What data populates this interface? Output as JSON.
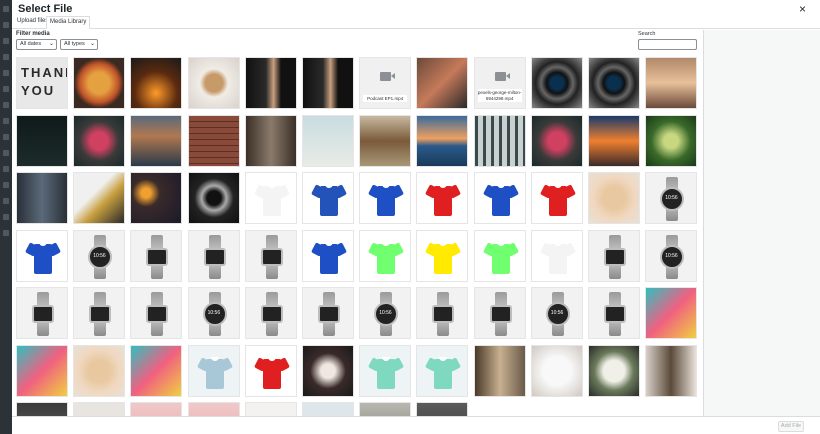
{
  "modal": {
    "title": "Select File",
    "close_glyph": "×"
  },
  "tabs": [
    {
      "label": "Upload files",
      "active": false
    },
    {
      "label": "Media Library",
      "active": true
    }
  ],
  "filters": {
    "label": "Filter media",
    "dates": "All dates",
    "types": "All types"
  },
  "search": {
    "label": "Search",
    "value": ""
  },
  "footer": {
    "add_label": "Add File"
  },
  "media": [
    [
      "text-thankyou",
      "pizza",
      "campfire",
      "coffee",
      "person-mic",
      "person-mic",
      "video:Podcast EP1.mp4",
      "person-laptop",
      "video:pexels-george-milton-6944298.mp4",
      "lens",
      "lens",
      "crowd"
    ],
    [
      "dark-silhouette",
      "red-rose",
      "lake",
      "brick-wall",
      "alley",
      "beach-pale",
      "dog-running",
      "sunset-sea",
      "forest",
      "red-rose",
      "sunset-sky",
      "forest-green"
    ],
    [
      "alley-dark",
      "hand-white",
      "bokeh-lights",
      "camera-lens",
      "shirt:#f4f4f4",
      "shirt-model:#2352b8",
      "shirt:#1f4fc4",
      "shirt:#e02020",
      "shirt:#1f4fc4",
      "shirt:#e02020",
      "tarts",
      "watch"
    ],
    [
      "shirt:#1f4fc4",
      "watch",
      "smartwatch",
      "smartwatch",
      "smartwatch",
      "shirt:#1f4fc4",
      "shirt:#6fff6f",
      "shirt:#ffea00",
      "shirt:#6fff6f",
      "shirt:#f4f4f4",
      "smartwatch",
      "watch"
    ],
    [
      "smartwatch",
      "smartwatch",
      "smartwatch",
      "watch",
      "smartwatch",
      "smartwatch",
      "watch",
      "smartwatch",
      "smartwatch",
      "watch",
      "smartwatch",
      "paint-abstract"
    ],
    [
      "paint-abstract",
      "tarts",
      "paint-abstract",
      "shirt-print:#a8c8d8",
      "shirt:#e02020",
      "rings",
      "shirt-print:#7fd8c0",
      "shirt-print:#7fd8c0",
      "shelf",
      "cake-white",
      "bouquet",
      "wedding-couple"
    ],
    [
      "dim-photo",
      "pale-photo",
      "pink-flowers",
      "pink-flowers",
      "white-photo",
      "light-photo",
      "grey-photo",
      "dark-grey"
    ]
  ]
}
